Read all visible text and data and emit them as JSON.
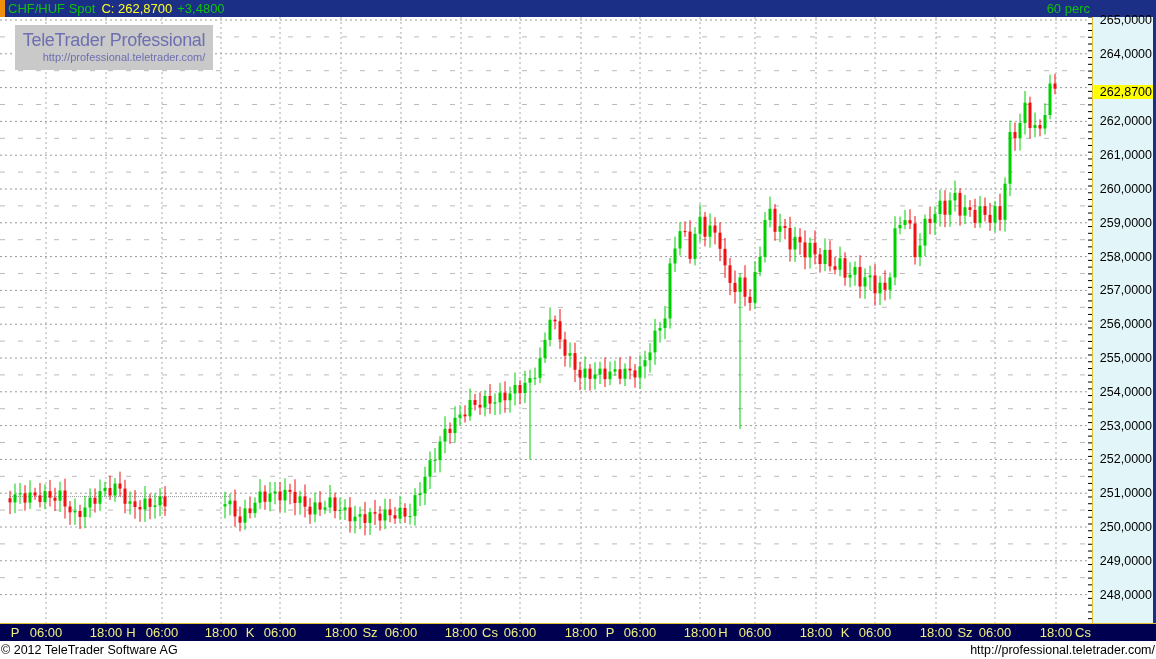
{
  "header": {
    "symbol": "CHF/HUF Spot",
    "close": "C: 262,8700",
    "change": "+3,4800",
    "interval": "60 perc"
  },
  "logo": {
    "title": "TeleTrader Professional",
    "url": "http://professional.teletrader.com/"
  },
  "y_axis": {
    "labels": [
      "265,0000",
      "264,0000",
      "262,0000",
      "261,0000",
      "260,0000",
      "259,0000",
      "258,0000",
      "257,0000",
      "256,0000",
      "255,0000",
      "254,0000",
      "253,0000",
      "252,0000",
      "251,0000",
      "250,0000",
      "249,0000",
      "248,0000"
    ],
    "last_price": "262,8700"
  },
  "x_axis": {
    "labels": [
      "P",
      "06:00",
      "18:00",
      "H",
      "06:00",
      "18:00",
      "K",
      "06:00",
      "18:00",
      "Sz",
      "06:00",
      "18:00",
      "Cs",
      "06:00",
      "18:00",
      "P",
      "06:00",
      "18:00",
      "H",
      "06:00",
      "18:00",
      "K",
      "06:00",
      "18:00",
      "Sz",
      "06:00",
      "18:00",
      "Cs"
    ]
  },
  "footer": {
    "copyright": "© 2012 TeleTrader Software AG",
    "url": "http://professional.teletrader.com/"
  }
}
